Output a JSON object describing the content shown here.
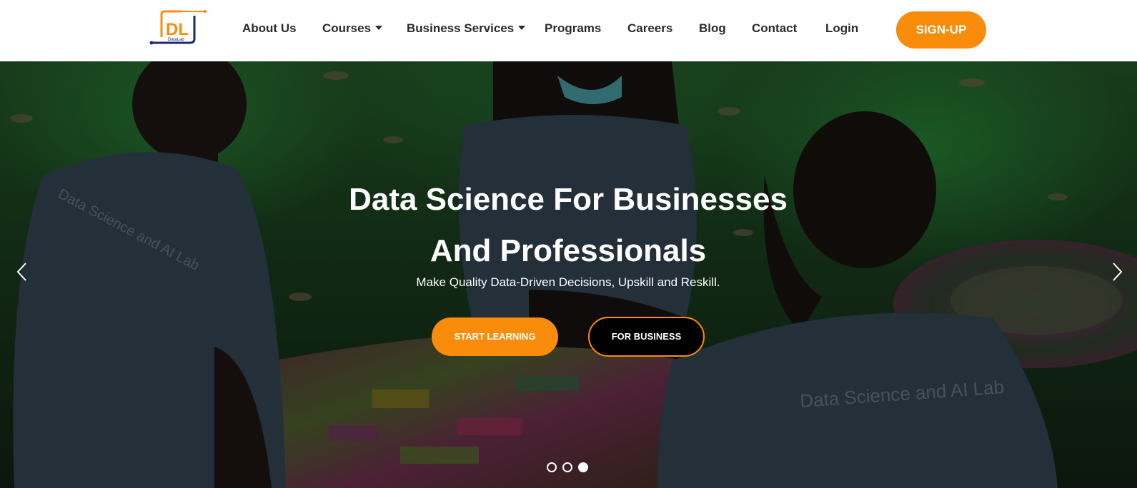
{
  "brand": {
    "logo_letters": "DL",
    "logo_subtext": "DataLab",
    "accent_color": "#f98c0a",
    "navy_color": "#1d2a6b"
  },
  "nav": {
    "items": [
      {
        "label": "About Us",
        "has_dropdown": false
      },
      {
        "label": "Courses",
        "has_dropdown": true
      },
      {
        "label": "Business Services",
        "has_dropdown": true
      },
      {
        "label": "Programs",
        "has_dropdown": false
      },
      {
        "label": "Careers",
        "has_dropdown": false
      },
      {
        "label": "Blog",
        "has_dropdown": false
      },
      {
        "label": "Contact",
        "has_dropdown": false
      },
      {
        "label": "Login",
        "has_dropdown": false
      }
    ],
    "signup_label": "SIGN-UP"
  },
  "hero": {
    "title_line1": "Data Science For Businesses",
    "title_line2": "And Professionals",
    "subtitle": "Make Quality Data-Driven Decisions, Upskill and Reskill.",
    "start_learning_label": "START LEARNING",
    "for_business_label": "FOR BUSINESS",
    "prev_icon": "chevron-left-icon",
    "next_icon": "chevron-right-icon",
    "slides_total": 3,
    "active_slide": 3,
    "shirt_text": "Data Science and AI Lab"
  }
}
